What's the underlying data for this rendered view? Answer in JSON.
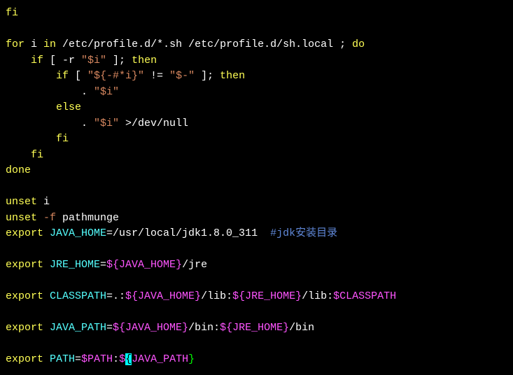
{
  "lines": {
    "l1": "fi",
    "l2": "",
    "l3_for": "for",
    "l3_i": " i ",
    "l3_in": "in",
    "l3_path": " /etc/profile.d/*.sh /etc/profile.d/sh.local ; ",
    "l3_do": "do",
    "l4_if": "    if",
    "l4_cond": " [ -r ",
    "l4_str": "\"$i\"",
    "l4_then": " ]; ",
    "l4_then2": "then",
    "l5_if": "        if",
    "l5_cond1": " [ ",
    "l5_str1": "\"${-#*i}\"",
    "l5_ne": " != ",
    "l5_str2": "\"$-\"",
    "l5_then": " ]; ",
    "l5_then2": "then",
    "l6_pad": "            . ",
    "l6_str": "\"$i\"",
    "l7_else": "        else",
    "l8_pad": "            . ",
    "l8_str": "\"$i\"",
    "l8_redir": " >/dev/null",
    "l9_fi": "        fi",
    "l10_fi": "    fi",
    "l11_done": "done",
    "l12": "",
    "l13_unset": "unset",
    "l13_i": " i",
    "l14_unset": "unset",
    "l14_f": " -f",
    "l14_path": " pathmunge",
    "l15_export": "export",
    "l15_var": " JAVA_HOME",
    "l15_eq": "=/usr/local/jdk1.8.0_311  ",
    "l15_comment": "#jdk安装目录",
    "l16": "",
    "l17_export": "export",
    "l17_var": " JRE_HOME",
    "l17_eq": "=",
    "l17_val": "${JAVA_HOME}",
    "l17_rest": "/jre",
    "l18": "",
    "l19_export": "export",
    "l19_var": " CLASSPATH",
    "l19_eq": "=.:",
    "l19_v1": "${JAVA_HOME}",
    "l19_m1": "/lib:",
    "l19_v2": "${JRE_HOME}",
    "l19_m2": "/lib:",
    "l19_v3": "$CLASSPATH",
    "l20": "",
    "l21_export": "export",
    "l21_var": " JAVA_PATH",
    "l21_eq": "=",
    "l21_v1": "${JAVA_HOME}",
    "l21_m1": "/bin:",
    "l21_v2": "${JRE_HOME}",
    "l21_m2": "/bin",
    "l22": "",
    "l23_export": "export",
    "l23_var": " PATH",
    "l23_eq": "=",
    "l23_v1": "$PATH",
    "l23_colon": ":",
    "l23_dollar": "$",
    "l23_open": "{",
    "l23_vname": "JAVA_PATH",
    "l23_close": "}"
  }
}
